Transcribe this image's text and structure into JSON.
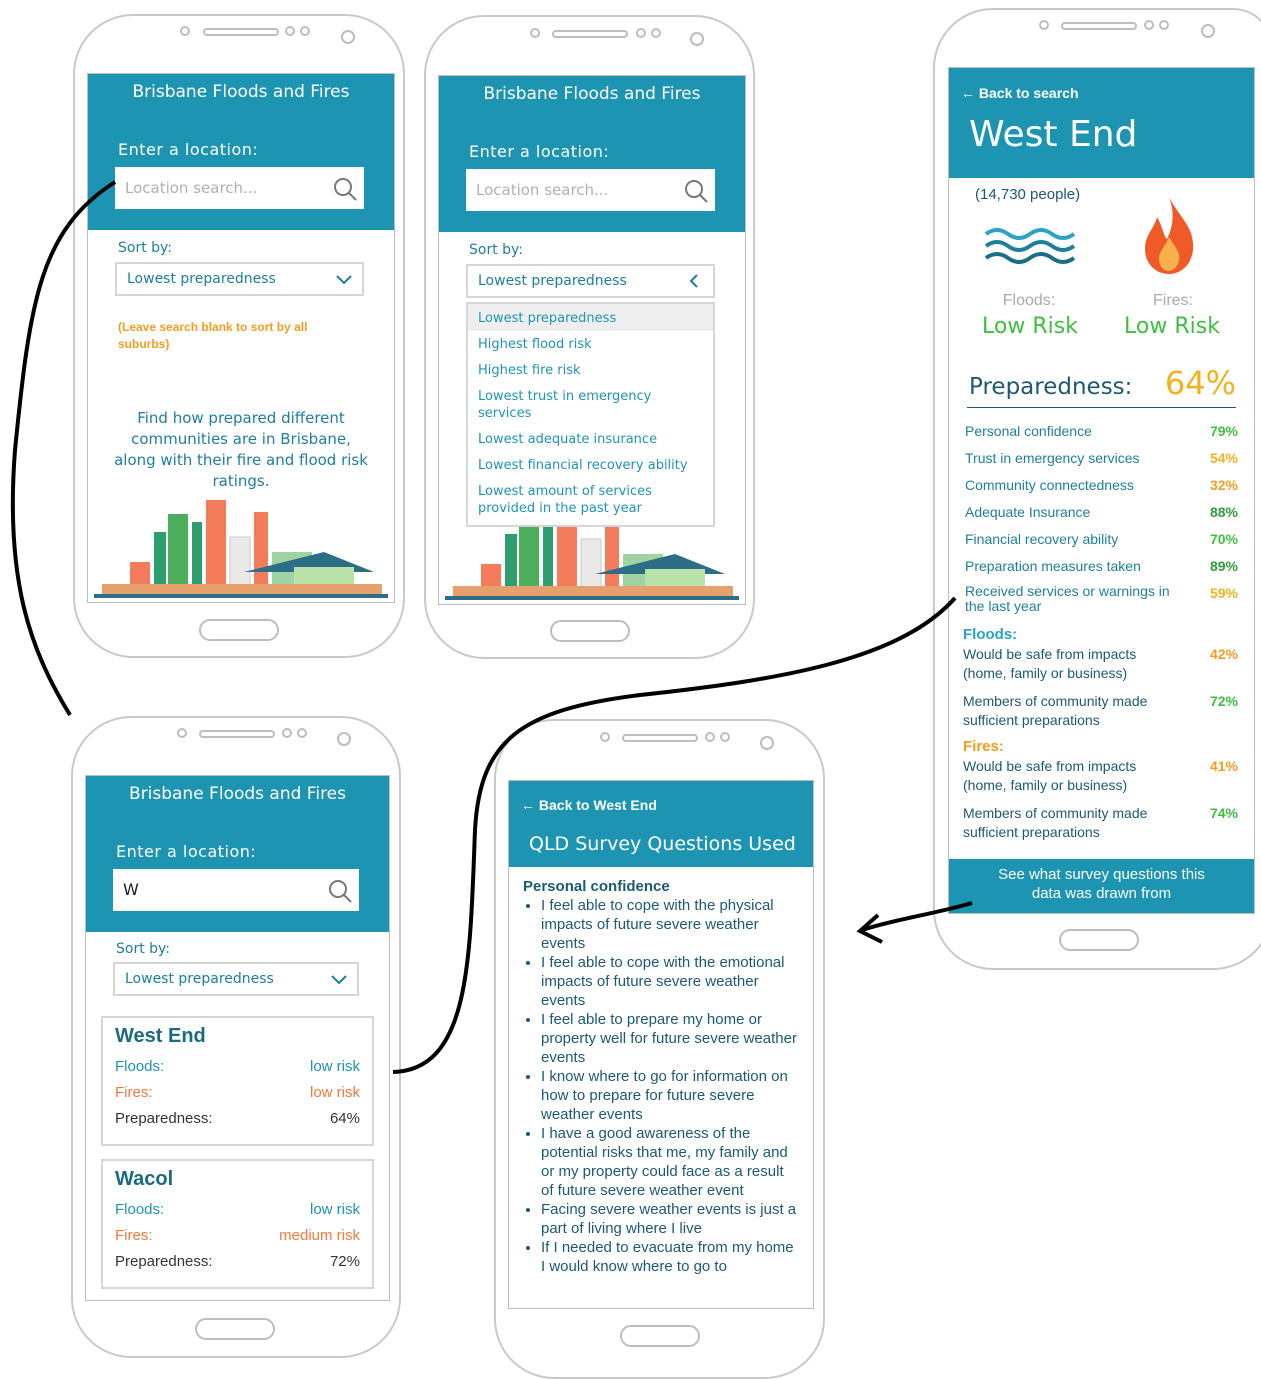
{
  "app": {
    "title": "Brisbane Floods and Fires"
  },
  "search": {
    "label": "Enter a location:",
    "placeholder": "Location search...",
    "typed_value": "W"
  },
  "sort": {
    "label": "Sort by:",
    "selected": "Lowest preparedness"
  },
  "hint": "(Leave search blank to sort by all suburbs)",
  "intro": "Find how prepared different communities are in Brisbane, along with their fire and flood risk ratings.",
  "sort_options": [
    "Lowest preparedness",
    "Highest flood risk",
    "Highest fire risk",
    "Lowest trust in emergency services",
    "Lowest adequate insurance",
    "Lowest financial recovery ability",
    "Lowest amount of services provided in the past year"
  ],
  "results": {
    "labels": {
      "floods": "Floods:",
      "fires": "Fires:",
      "preparedness": "Preparedness:"
    },
    "items": [
      {
        "name": "West End",
        "floods": "low risk",
        "fires": "low risk",
        "preparedness": "64%"
      },
      {
        "name": "Wacol",
        "floods": "low risk",
        "fires": "medium risk",
        "preparedness": "72%"
      }
    ]
  },
  "detail": {
    "back": "← Back to search",
    "suburb": "West End",
    "population": "(14,730 people)",
    "floods_label": "Floods:",
    "floods_risk": "Low Risk",
    "fires_label": "Fires:",
    "fires_risk": "Low Risk",
    "preparedness_label": "Preparedness:",
    "preparedness_value": "64%",
    "metrics": [
      {
        "label": "Personal confidence",
        "value": "79%"
      },
      {
        "label": "Trust in emergency services",
        "value": "54%"
      },
      {
        "label": "Community connectedness",
        "value": "32%"
      },
      {
        "label": "Adequate Insurance",
        "value": "88%"
      },
      {
        "label": "Financial recovery ability",
        "value": "70%"
      },
      {
        "label": "Preparation measures taken",
        "value": "89%"
      },
      {
        "label": "Received services or warnings in the last year",
        "value": "59%"
      }
    ],
    "floods_heading": "Floods:",
    "floods_items": [
      {
        "label": "Would be safe from impacts (home, family or business)",
        "value": "42%"
      },
      {
        "label": "Members of community made sufficient preparations",
        "value": "72%"
      }
    ],
    "fires_heading": "Fires:",
    "fires_items": [
      {
        "label": "Would be safe from impacts (home, family or business)",
        "value": "41%"
      },
      {
        "label": "Members of community made sufficient preparations",
        "value": "74%"
      }
    ],
    "footer": "See what survey questions this data was drawn from"
  },
  "survey": {
    "back": "← Back to West End",
    "title": "QLD Survey Questions Used",
    "section": "Personal confidence",
    "questions": [
      "I feel able to cope with the physical impacts of future severe weather events",
      "I feel able to cope with the emotional impacts of future severe weather events",
      "I feel able to prepare my home or property well for future severe weather events",
      "I know where to go for information on how to prepare for future severe weather events",
      "I have a good awareness of the potential risks that me, my family and or my property could face as a result of future severe weather event",
      "Facing severe weather events is just a part of living where I live",
      "If I needed to evacuate from my home I would know where to go to"
    ]
  },
  "colors": {
    "primary": "#1e94b3",
    "orange": "#f39c1f",
    "green": "#3fbf3f",
    "yellow": "#f2b21b"
  }
}
